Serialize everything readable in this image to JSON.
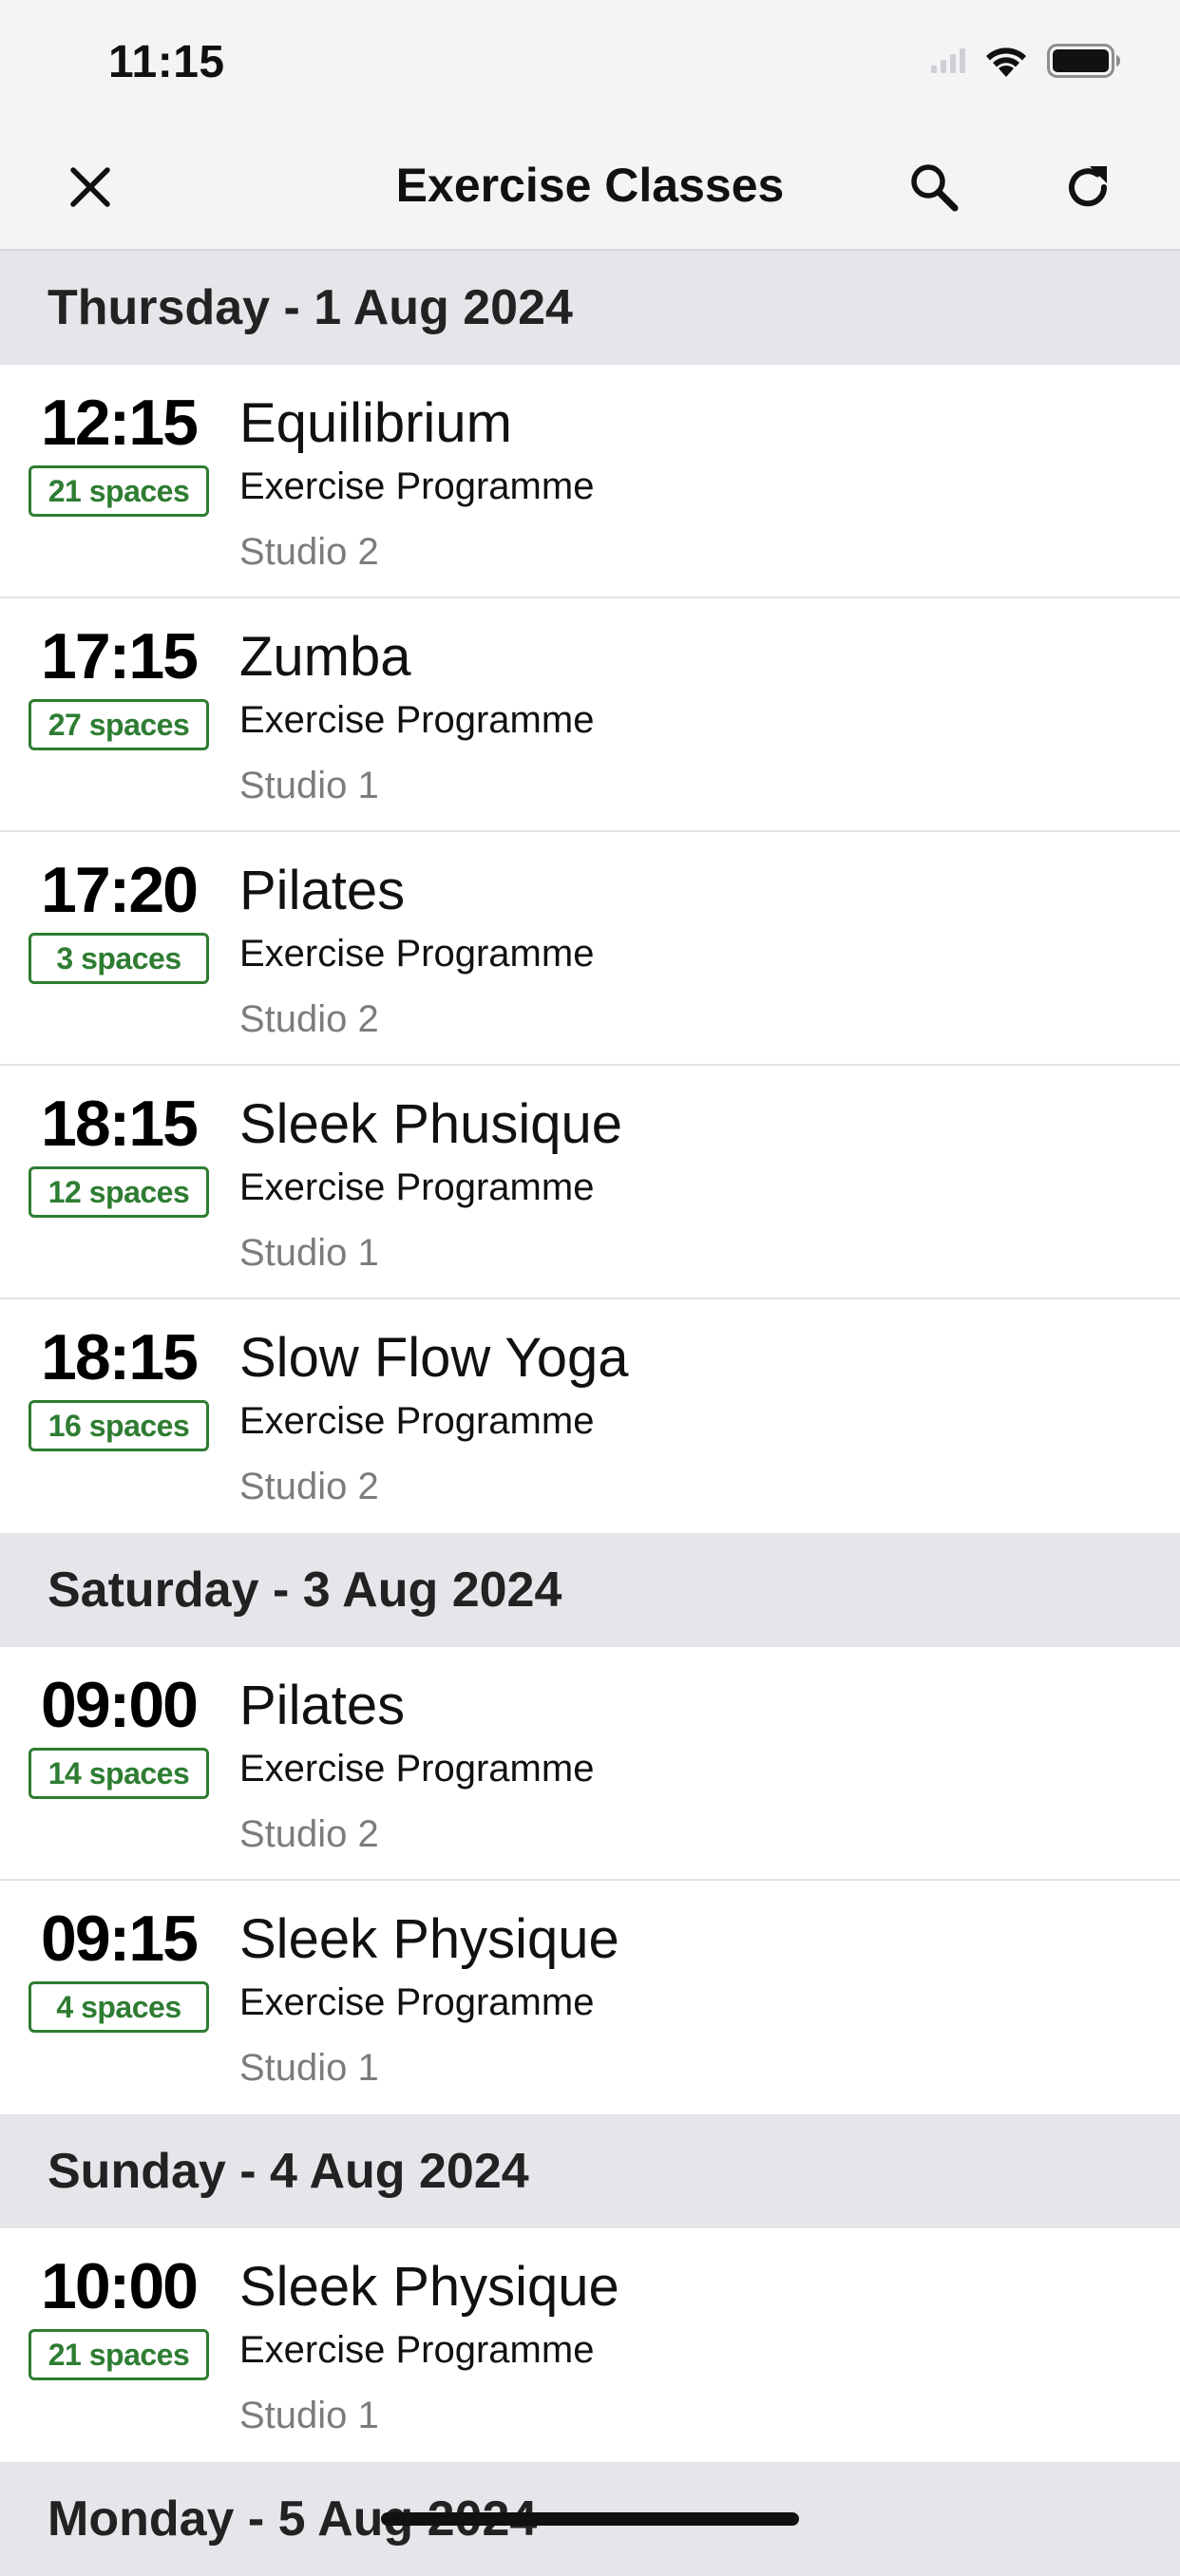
{
  "status_bar": {
    "time": "11:15"
  },
  "nav": {
    "title": "Exercise Classes",
    "close_icon": "close-icon",
    "search_icon": "search-icon",
    "refresh_icon": "refresh-icon"
  },
  "days": [
    {
      "header": "Thursday - 1 Aug 2024",
      "classes": [
        {
          "time": "12:15",
          "spaces": "21 spaces",
          "name": "Equilibrium",
          "programme": "Exercise Programme",
          "studio": "Studio 2"
        },
        {
          "time": "17:15",
          "spaces": "27 spaces",
          "name": "Zumba",
          "programme": "Exercise Programme",
          "studio": "Studio 1"
        },
        {
          "time": "17:20",
          "spaces": "3 spaces",
          "name": "Pilates",
          "programme": "Exercise Programme",
          "studio": "Studio 2"
        },
        {
          "time": "18:15",
          "spaces": "12 spaces",
          "name": "Sleek Phusique",
          "programme": "Exercise Programme",
          "studio": "Studio 1"
        },
        {
          "time": "18:15",
          "spaces": "16 spaces",
          "name": "Slow Flow Yoga",
          "programme": "Exercise Programme",
          "studio": "Studio 2"
        }
      ]
    },
    {
      "header": "Saturday - 3 Aug 2024",
      "classes": [
        {
          "time": "09:00",
          "spaces": "14 spaces",
          "name": "Pilates",
          "programme": "Exercise Programme",
          "studio": "Studio 2"
        },
        {
          "time": "09:15",
          "spaces": "4 spaces",
          "name": "Sleek Physique",
          "programme": "Exercise Programme",
          "studio": "Studio 1"
        }
      ]
    },
    {
      "header": "Sunday - 4 Aug 2024",
      "classes": [
        {
          "time": "10:00",
          "spaces": "21 spaces",
          "name": "Sleek Physique",
          "programme": "Exercise Programme",
          "studio": "Studio 1"
        }
      ]
    },
    {
      "header": "Monday - 5 Aug 2024",
      "classes": []
    }
  ],
  "colors": {
    "spaces_green": "#2e7d32",
    "section_bg": "#e5e5ea",
    "nav_bg": "#f4f4f6"
  }
}
